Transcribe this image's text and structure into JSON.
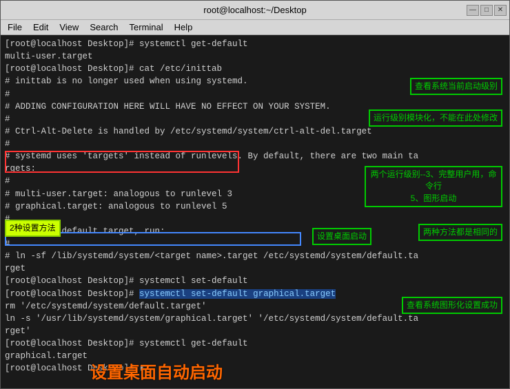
{
  "window": {
    "title": "root@localhost:~/Desktop",
    "menu_items": [
      "File",
      "Edit",
      "View",
      "Search",
      "Terminal",
      "Help"
    ]
  },
  "terminal": {
    "lines": [
      "[root@localhost Desktop]# systemctl get-default",
      "multi-user.target",
      "[root@localhost Desktop]# cat /etc/inittab",
      "# inittab is no longer used when using systemd.",
      "#",
      "# ADDING CONFIGURATION HERE WILL HAVE NO EFFECT ON YOUR SYSTEM.",
      "#",
      "# Ctrl-Alt-Delete is handled by /etc/systemd/system/ctrl-alt-del.target",
      "#",
      "# systemd uses 'targets' instead of runlevels. By default, there are two main ta",
      "rgets:",
      "#",
      "# multi-user.target: analogous to runlevel 3",
      "# graphical.target: analogous to runlevel 5",
      "#",
      "# To set a default target, run:",
      "#",
      "# ln -sf /lib/systemd/system/<target name>.target /etc/systemd/system/default.ta",
      "rget",
      "[root@localhost Desktop]# systemctl set-default",
      "[root@localhost Desktop]# systemctl set-default graphical.target",
      "rm '/etc/systemd/system/default.target'",
      "ln -s '/usr/lib/systemd/system/graphical.target' '/etc/systemd/system/default.ta",
      "rget'",
      "[root@localhost Desktop]# systemctl get-default",
      "graphical.target",
      "[root@localhost Desktop]# ▮"
    ]
  },
  "annotations": {
    "check_runlevel": "查看系统当前启动级别",
    "modular": "运行级别模块化，不能在此处修改",
    "two_levels": "两个运行级别--3、完整用户用，命令行\n5、图形启动",
    "two_methods": "2种设置方法",
    "set_desktop": "设置桌面启动",
    "same_methods": "两种方法都是相同的",
    "check_success": "查看系统图形化设置成功",
    "big_title": "设置桌面自动启动"
  },
  "title_buttons": [
    "—",
    "□",
    "✕"
  ]
}
